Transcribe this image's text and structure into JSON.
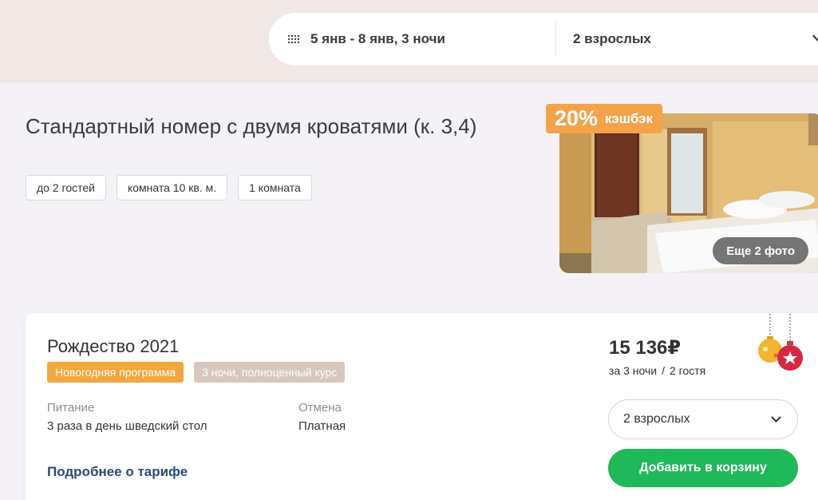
{
  "search": {
    "dates": "5 янв - 8 янв, 3 ночи",
    "guests": "2 взрослых"
  },
  "room": {
    "title": "Стандартный номер с двумя кроватями (к. 3,4)",
    "tags": [
      "до 2 гостей",
      "комната 10 кв. м.",
      "1 комната"
    ],
    "cashback_percent": "20%",
    "cashback_label": "кэшбэк",
    "more_photos": "Еще 2 фото"
  },
  "tariff": {
    "name": "Рождество 2021",
    "badges": [
      "Новогодняя программа",
      "3 ночи, полноценный курс"
    ],
    "meals_label": "Питание",
    "meals_value": "3 раза в день шведский стол",
    "cancel_label": "Отмена",
    "cancel_value": "Платная",
    "more_link": "Подробнее о тарифе",
    "price": "15 136₽",
    "price_nights": "за 3 ночи",
    "price_separator": "/",
    "price_guests": "2 гостя",
    "guest_select": "2 взрослых",
    "add_button": "Добавить в корзину"
  },
  "colors": {
    "accent_green": "#1fb85a",
    "cashback_orange": "#f4a34b",
    "badge_orange": "#f2a73e",
    "badge_gray": "#d7c7bd",
    "link_blue": "#2b4a7a"
  }
}
